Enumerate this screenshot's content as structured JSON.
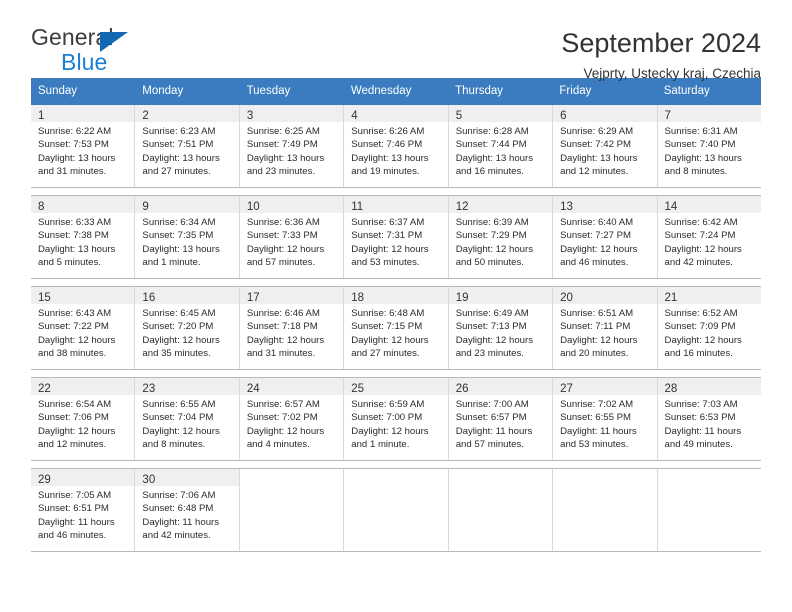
{
  "brand": {
    "name_top": "General",
    "name_bottom": "Blue",
    "triangle_color": "#1268b3",
    "blue_color": "#1b7fd4"
  },
  "header": {
    "title": "September 2024",
    "subtitle": "Vejprty, Ustecky kraj, Czechia"
  },
  "colors": {
    "header_row_bg": "#3a7cbf",
    "header_row_text": "#ffffff",
    "daynum_band_bg": "#efefef",
    "cell_bg": "#ffffff",
    "grid_line": "#d9d9d9"
  },
  "weekdays": [
    "Sunday",
    "Monday",
    "Tuesday",
    "Wednesday",
    "Thursday",
    "Friday",
    "Saturday"
  ],
  "labels": {
    "sunrise_prefix": "Sunrise:",
    "sunset_prefix": "Sunset:",
    "daylight_prefix": "Daylight:"
  },
  "weeks": [
    [
      {
        "day": "1",
        "sunrise": "Sunrise: 6:22 AM",
        "sunset": "Sunset: 7:53 PM",
        "daylight1": "Daylight: 13 hours",
        "daylight2": "and 31 minutes."
      },
      {
        "day": "2",
        "sunrise": "Sunrise: 6:23 AM",
        "sunset": "Sunset: 7:51 PM",
        "daylight1": "Daylight: 13 hours",
        "daylight2": "and 27 minutes."
      },
      {
        "day": "3",
        "sunrise": "Sunrise: 6:25 AM",
        "sunset": "Sunset: 7:49 PM",
        "daylight1": "Daylight: 13 hours",
        "daylight2": "and 23 minutes."
      },
      {
        "day": "4",
        "sunrise": "Sunrise: 6:26 AM",
        "sunset": "Sunset: 7:46 PM",
        "daylight1": "Daylight: 13 hours",
        "daylight2": "and 19 minutes."
      },
      {
        "day": "5",
        "sunrise": "Sunrise: 6:28 AM",
        "sunset": "Sunset: 7:44 PM",
        "daylight1": "Daylight: 13 hours",
        "daylight2": "and 16 minutes."
      },
      {
        "day": "6",
        "sunrise": "Sunrise: 6:29 AM",
        "sunset": "Sunset: 7:42 PM",
        "daylight1": "Daylight: 13 hours",
        "daylight2": "and 12 minutes."
      },
      {
        "day": "7",
        "sunrise": "Sunrise: 6:31 AM",
        "sunset": "Sunset: 7:40 PM",
        "daylight1": "Daylight: 13 hours",
        "daylight2": "and 8 minutes."
      }
    ],
    [
      {
        "day": "8",
        "sunrise": "Sunrise: 6:33 AM",
        "sunset": "Sunset: 7:38 PM",
        "daylight1": "Daylight: 13 hours",
        "daylight2": "and 5 minutes."
      },
      {
        "day": "9",
        "sunrise": "Sunrise: 6:34 AM",
        "sunset": "Sunset: 7:35 PM",
        "daylight1": "Daylight: 13 hours",
        "daylight2": "and 1 minute."
      },
      {
        "day": "10",
        "sunrise": "Sunrise: 6:36 AM",
        "sunset": "Sunset: 7:33 PM",
        "daylight1": "Daylight: 12 hours",
        "daylight2": "and 57 minutes."
      },
      {
        "day": "11",
        "sunrise": "Sunrise: 6:37 AM",
        "sunset": "Sunset: 7:31 PM",
        "daylight1": "Daylight: 12 hours",
        "daylight2": "and 53 minutes."
      },
      {
        "day": "12",
        "sunrise": "Sunrise: 6:39 AM",
        "sunset": "Sunset: 7:29 PM",
        "daylight1": "Daylight: 12 hours",
        "daylight2": "and 50 minutes."
      },
      {
        "day": "13",
        "sunrise": "Sunrise: 6:40 AM",
        "sunset": "Sunset: 7:27 PM",
        "daylight1": "Daylight: 12 hours",
        "daylight2": "and 46 minutes."
      },
      {
        "day": "14",
        "sunrise": "Sunrise: 6:42 AM",
        "sunset": "Sunset: 7:24 PM",
        "daylight1": "Daylight: 12 hours",
        "daylight2": "and 42 minutes."
      }
    ],
    [
      {
        "day": "15",
        "sunrise": "Sunrise: 6:43 AM",
        "sunset": "Sunset: 7:22 PM",
        "daylight1": "Daylight: 12 hours",
        "daylight2": "and 38 minutes."
      },
      {
        "day": "16",
        "sunrise": "Sunrise: 6:45 AM",
        "sunset": "Sunset: 7:20 PM",
        "daylight1": "Daylight: 12 hours",
        "daylight2": "and 35 minutes."
      },
      {
        "day": "17",
        "sunrise": "Sunrise: 6:46 AM",
        "sunset": "Sunset: 7:18 PM",
        "daylight1": "Daylight: 12 hours",
        "daylight2": "and 31 minutes."
      },
      {
        "day": "18",
        "sunrise": "Sunrise: 6:48 AM",
        "sunset": "Sunset: 7:15 PM",
        "daylight1": "Daylight: 12 hours",
        "daylight2": "and 27 minutes."
      },
      {
        "day": "19",
        "sunrise": "Sunrise: 6:49 AM",
        "sunset": "Sunset: 7:13 PM",
        "daylight1": "Daylight: 12 hours",
        "daylight2": "and 23 minutes."
      },
      {
        "day": "20",
        "sunrise": "Sunrise: 6:51 AM",
        "sunset": "Sunset: 7:11 PM",
        "daylight1": "Daylight: 12 hours",
        "daylight2": "and 20 minutes."
      },
      {
        "day": "21",
        "sunrise": "Sunrise: 6:52 AM",
        "sunset": "Sunset: 7:09 PM",
        "daylight1": "Daylight: 12 hours",
        "daylight2": "and 16 minutes."
      }
    ],
    [
      {
        "day": "22",
        "sunrise": "Sunrise: 6:54 AM",
        "sunset": "Sunset: 7:06 PM",
        "daylight1": "Daylight: 12 hours",
        "daylight2": "and 12 minutes."
      },
      {
        "day": "23",
        "sunrise": "Sunrise: 6:55 AM",
        "sunset": "Sunset: 7:04 PM",
        "daylight1": "Daylight: 12 hours",
        "daylight2": "and 8 minutes."
      },
      {
        "day": "24",
        "sunrise": "Sunrise: 6:57 AM",
        "sunset": "Sunset: 7:02 PM",
        "daylight1": "Daylight: 12 hours",
        "daylight2": "and 4 minutes."
      },
      {
        "day": "25",
        "sunrise": "Sunrise: 6:59 AM",
        "sunset": "Sunset: 7:00 PM",
        "daylight1": "Daylight: 12 hours",
        "daylight2": "and 1 minute."
      },
      {
        "day": "26",
        "sunrise": "Sunrise: 7:00 AM",
        "sunset": "Sunset: 6:57 PM",
        "daylight1": "Daylight: 11 hours",
        "daylight2": "and 57 minutes."
      },
      {
        "day": "27",
        "sunrise": "Sunrise: 7:02 AM",
        "sunset": "Sunset: 6:55 PM",
        "daylight1": "Daylight: 11 hours",
        "daylight2": "and 53 minutes."
      },
      {
        "day": "28",
        "sunrise": "Sunrise: 7:03 AM",
        "sunset": "Sunset: 6:53 PM",
        "daylight1": "Daylight: 11 hours",
        "daylight2": "and 49 minutes."
      }
    ],
    [
      {
        "day": "29",
        "sunrise": "Sunrise: 7:05 AM",
        "sunset": "Sunset: 6:51 PM",
        "daylight1": "Daylight: 11 hours",
        "daylight2": "and 46 minutes."
      },
      {
        "day": "30",
        "sunrise": "Sunrise: 7:06 AM",
        "sunset": "Sunset: 6:48 PM",
        "daylight1": "Daylight: 11 hours",
        "daylight2": "and 42 minutes."
      },
      {
        "day": "",
        "sunrise": "",
        "sunset": "",
        "daylight1": "",
        "daylight2": ""
      },
      {
        "day": "",
        "sunrise": "",
        "sunset": "",
        "daylight1": "",
        "daylight2": ""
      },
      {
        "day": "",
        "sunrise": "",
        "sunset": "",
        "daylight1": "",
        "daylight2": ""
      },
      {
        "day": "",
        "sunrise": "",
        "sunset": "",
        "daylight1": "",
        "daylight2": ""
      },
      {
        "day": "",
        "sunrise": "",
        "sunset": "",
        "daylight1": "",
        "daylight2": ""
      }
    ]
  ]
}
